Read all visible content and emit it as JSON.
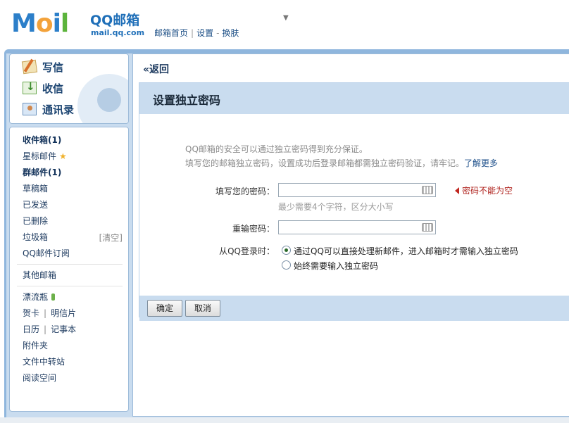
{
  "header": {
    "logo_text": "Mail",
    "brand": "QQ邮箱",
    "domain": "mail.qq.com",
    "nav": [
      "邮箱首页",
      "设置",
      "换肤"
    ]
  },
  "sidebar": {
    "actions": [
      {
        "label": "写信",
        "icon": "write-icon"
      },
      {
        "label": "收信",
        "icon": "inbox-download-icon"
      },
      {
        "label": "通讯录",
        "icon": "contacts-icon"
      }
    ],
    "folders": {
      "inbox": "收件箱(1)",
      "starred": "星标邮件",
      "group": "群邮件(1)",
      "drafts": "草稿箱",
      "sent": "已发送",
      "deleted": "已删除",
      "spam": "垃圾箱",
      "spam_clear": "[清空]",
      "subscriptions": "QQ邮件订阅",
      "other": "其他邮箱",
      "bottle": "漂流瓶",
      "card": "贺卡",
      "postcard": "明信片",
      "calendar": "日历",
      "notes": "记事本",
      "attachments": "附件夹",
      "transfer": "文件中转站",
      "reading": "阅读空间"
    }
  },
  "main": {
    "back_label": "«返回",
    "title": "设置独立密码",
    "info_line1": "QQ邮箱的安全可以通过独立密码得到充分保证。",
    "info_line2": "填写您的邮箱独立密码，设置成功后登录邮箱都需独立密码验证，请牢记。",
    "info_more": "了解更多",
    "password_label": "填写您的密码：",
    "password_value": "",
    "password_hint": "最少需要4个字符，区分大小写",
    "password_error": "密码不能为空",
    "confirm_label": "重输密码：",
    "confirm_value": "",
    "login_label": "从QQ登录时：",
    "option1": "通过QQ可以直接处理新邮件，进入邮箱时才需输入独立密码",
    "option2": "始终需要输入独立密码",
    "selected_option": 1,
    "ok_button": "确定",
    "cancel_button": "取消"
  },
  "colors": {
    "frame_blue": "#8fb6dd",
    "panel_blue": "#c9dcef",
    "error_red": "#b0241f",
    "link_blue": "#1d4f8a"
  }
}
